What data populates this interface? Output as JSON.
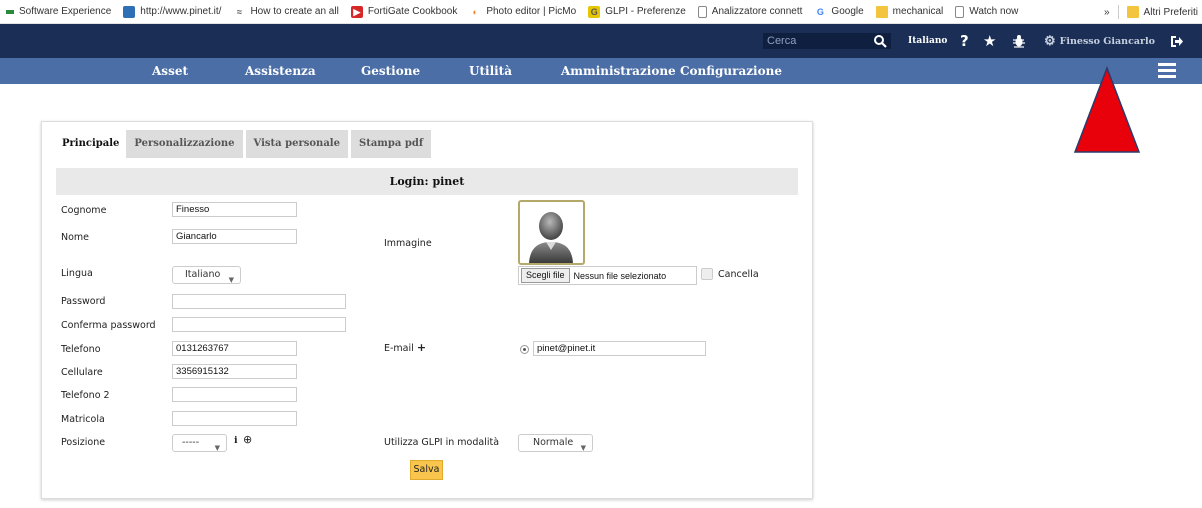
{
  "bookmarks": {
    "items": [
      {
        "label": "Software Experience",
        "icon": "apps-icon",
        "color": "#2a8a3b"
      },
      {
        "label": "http://www.pinet.it/",
        "icon": "site-icon",
        "color": "#2f6fb5"
      },
      {
        "label": "How to create an all",
        "icon": "wave-icon",
        "color": "#6a6a6a"
      },
      {
        "label": "FortiGate Cookbook",
        "icon": "youtube-icon",
        "color": "#d62828"
      },
      {
        "label": "Photo editor | PicMo",
        "icon": "picmonkey-icon",
        "color": "#f07f2a"
      },
      {
        "label": "GLPI - Preferenze",
        "icon": "glpi-icon",
        "color": "#e5c600"
      },
      {
        "label": "Analizzatore connett",
        "icon": "page-icon",
        "color": "#888888"
      },
      {
        "label": "Google",
        "icon": "google-icon",
        "color": "#4285f4"
      },
      {
        "label": "mechanical",
        "icon": "folder-icon",
        "color": "#f3c440"
      },
      {
        "label": "Watch now",
        "icon": "page-icon",
        "color": "#888888"
      }
    ],
    "more": "»",
    "other_folder": "Altri Preferiti"
  },
  "header": {
    "search_placeholder": "Cerca",
    "language": "Italiano",
    "help_icon": "question-icon",
    "favorites_icon": "star-icon",
    "bug_icon": "bug-icon",
    "user_name": "Finesso Giancarlo",
    "logout_icon": "logout-icon"
  },
  "menu": {
    "items": [
      "Asset",
      "Assistenza",
      "Gestione",
      "Utilità",
      "Amministrazione",
      "Configurazione"
    ]
  },
  "tabs": [
    "Principale",
    "Personalizzazione",
    "Vista personale",
    "Stampa pdf"
  ],
  "form": {
    "title": "Login: pinet",
    "fields": {
      "cognome": {
        "label": "Cognome",
        "value": "Finesso"
      },
      "nome": {
        "label": "Nome",
        "value": "Giancarlo"
      },
      "lingua": {
        "label": "Lingua",
        "value": "Italiano"
      },
      "password": {
        "label": "Password",
        "value": ""
      },
      "conferma": {
        "label": "Conferma password",
        "value": ""
      },
      "telefono": {
        "label": "Telefono",
        "value": "0131263767"
      },
      "cellulare": {
        "label": "Cellulare",
        "value": "3356915132"
      },
      "telefono2": {
        "label": "Telefono 2",
        "value": ""
      },
      "matricola": {
        "label": "Matricola",
        "value": ""
      },
      "posizione": {
        "label": "Posizione",
        "value": "-----"
      }
    },
    "immagine_label": "Immagine",
    "file_button": "Scegli file",
    "file_name": "Nessun file selezionato",
    "cancella_label": "Cancella",
    "email_label": "E-mail",
    "email_value": "pinet@pinet.it",
    "mode_label": "Utilizza GLPI in modalità",
    "mode_value": "Normale",
    "save_label": "Salva"
  },
  "colors": {
    "header_bg": "#1b2f56",
    "menu_bg": "#4b6ea7",
    "save_bg": "#f9c54d",
    "arrow": "#e8000b"
  }
}
